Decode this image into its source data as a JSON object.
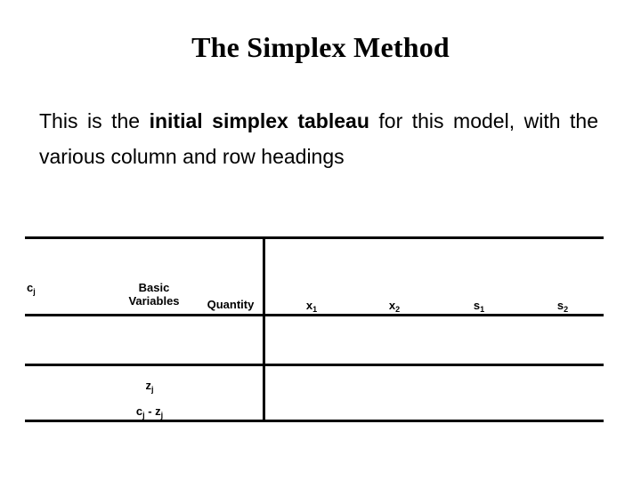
{
  "slide": {
    "title": "The Simplex Method",
    "background_color": "#ffffff",
    "text_color": "#000000"
  },
  "body": {
    "lead": "This is the",
    "emphasis": "initial simplex tableau",
    "tail": "for this model, with the various column and row headings"
  },
  "tableau": {
    "row_label_column_header": "c",
    "row_label_column_header_sub": "j",
    "basic_variables_line1": "Basic",
    "basic_variables_line2": "Variables",
    "quantity_header": "Quantity",
    "columns": [
      {
        "symbol": "x",
        "sub": "1"
      },
      {
        "symbol": "x",
        "sub": "2"
      },
      {
        "symbol": "s",
        "sub": "1"
      },
      {
        "symbol": "s",
        "sub": "2"
      }
    ],
    "footer_rows": [
      {
        "symbol": "z",
        "sub": "j"
      },
      {
        "symbol": "c",
        "sub": "j"
      }
    ],
    "cj_minus_zj_prefix": "c",
    "cj_minus_zj_prefix_sub": "j",
    "cj_minus_zj_operator": " - ",
    "cj_minus_zj_suffix": "z",
    "cj_minus_zj_suffix_sub": "j",
    "zj_label": "z",
    "zj_label_sub": "j",
    "rule_color": "#000000"
  }
}
